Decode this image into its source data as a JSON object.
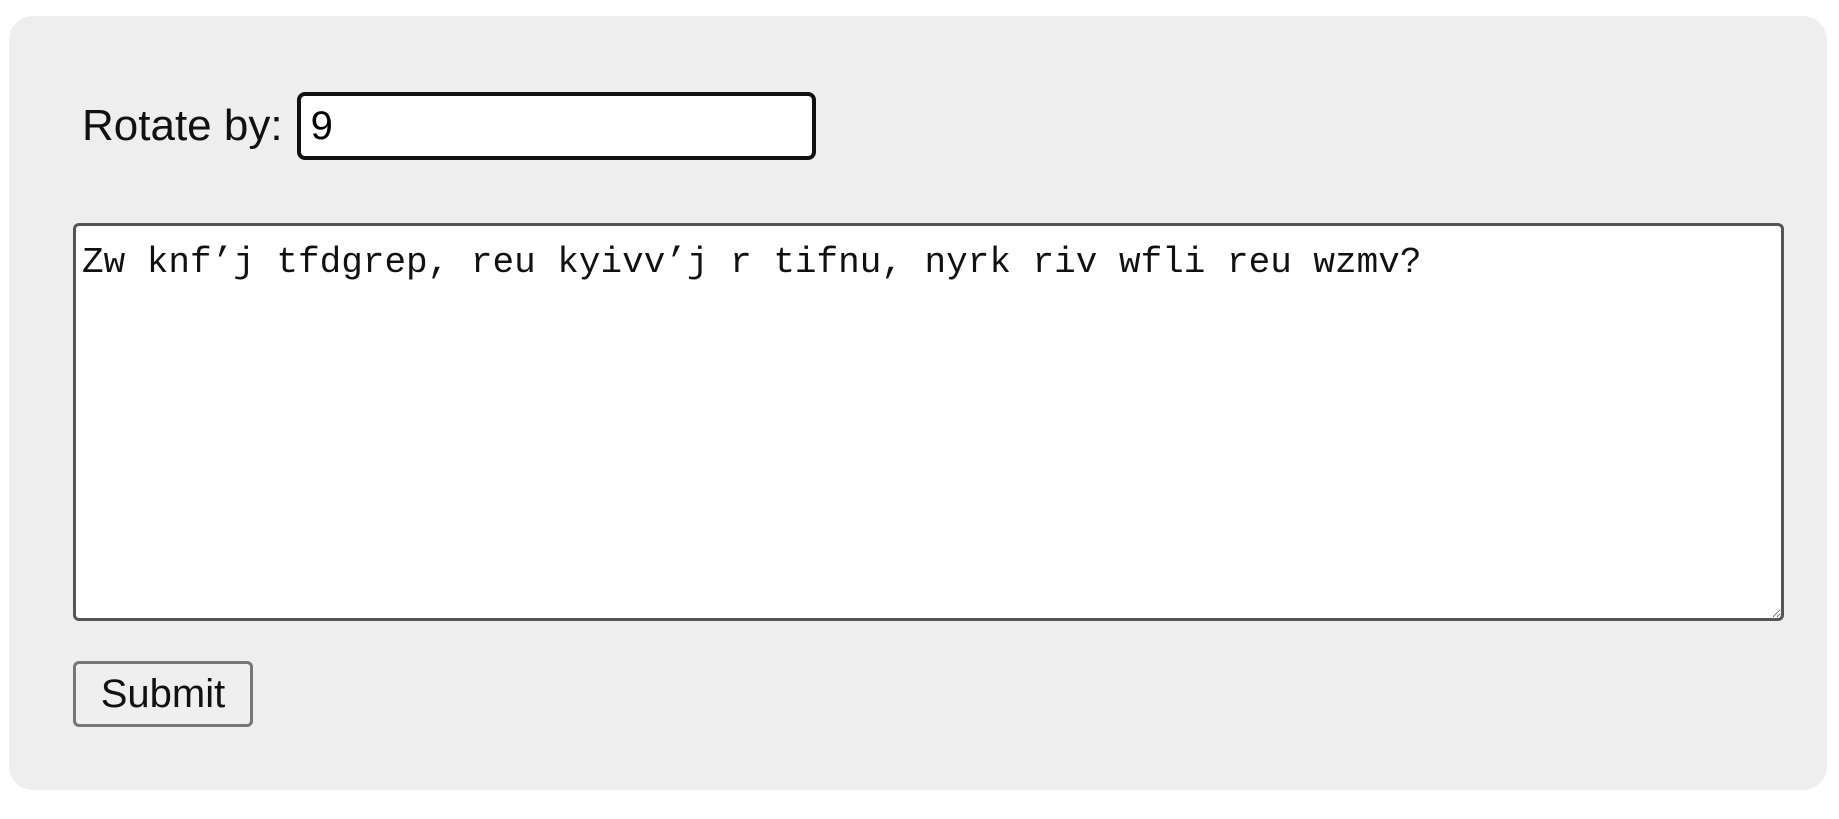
{
  "form": {
    "rotate_label": "Rotate by:",
    "rotate_value": "9",
    "message_text": "Zw knf’j tfdgrep, reu kyivv’j r tifnu, nyrk riv wfli reu wzmv?",
    "submit_label": "Submit"
  }
}
